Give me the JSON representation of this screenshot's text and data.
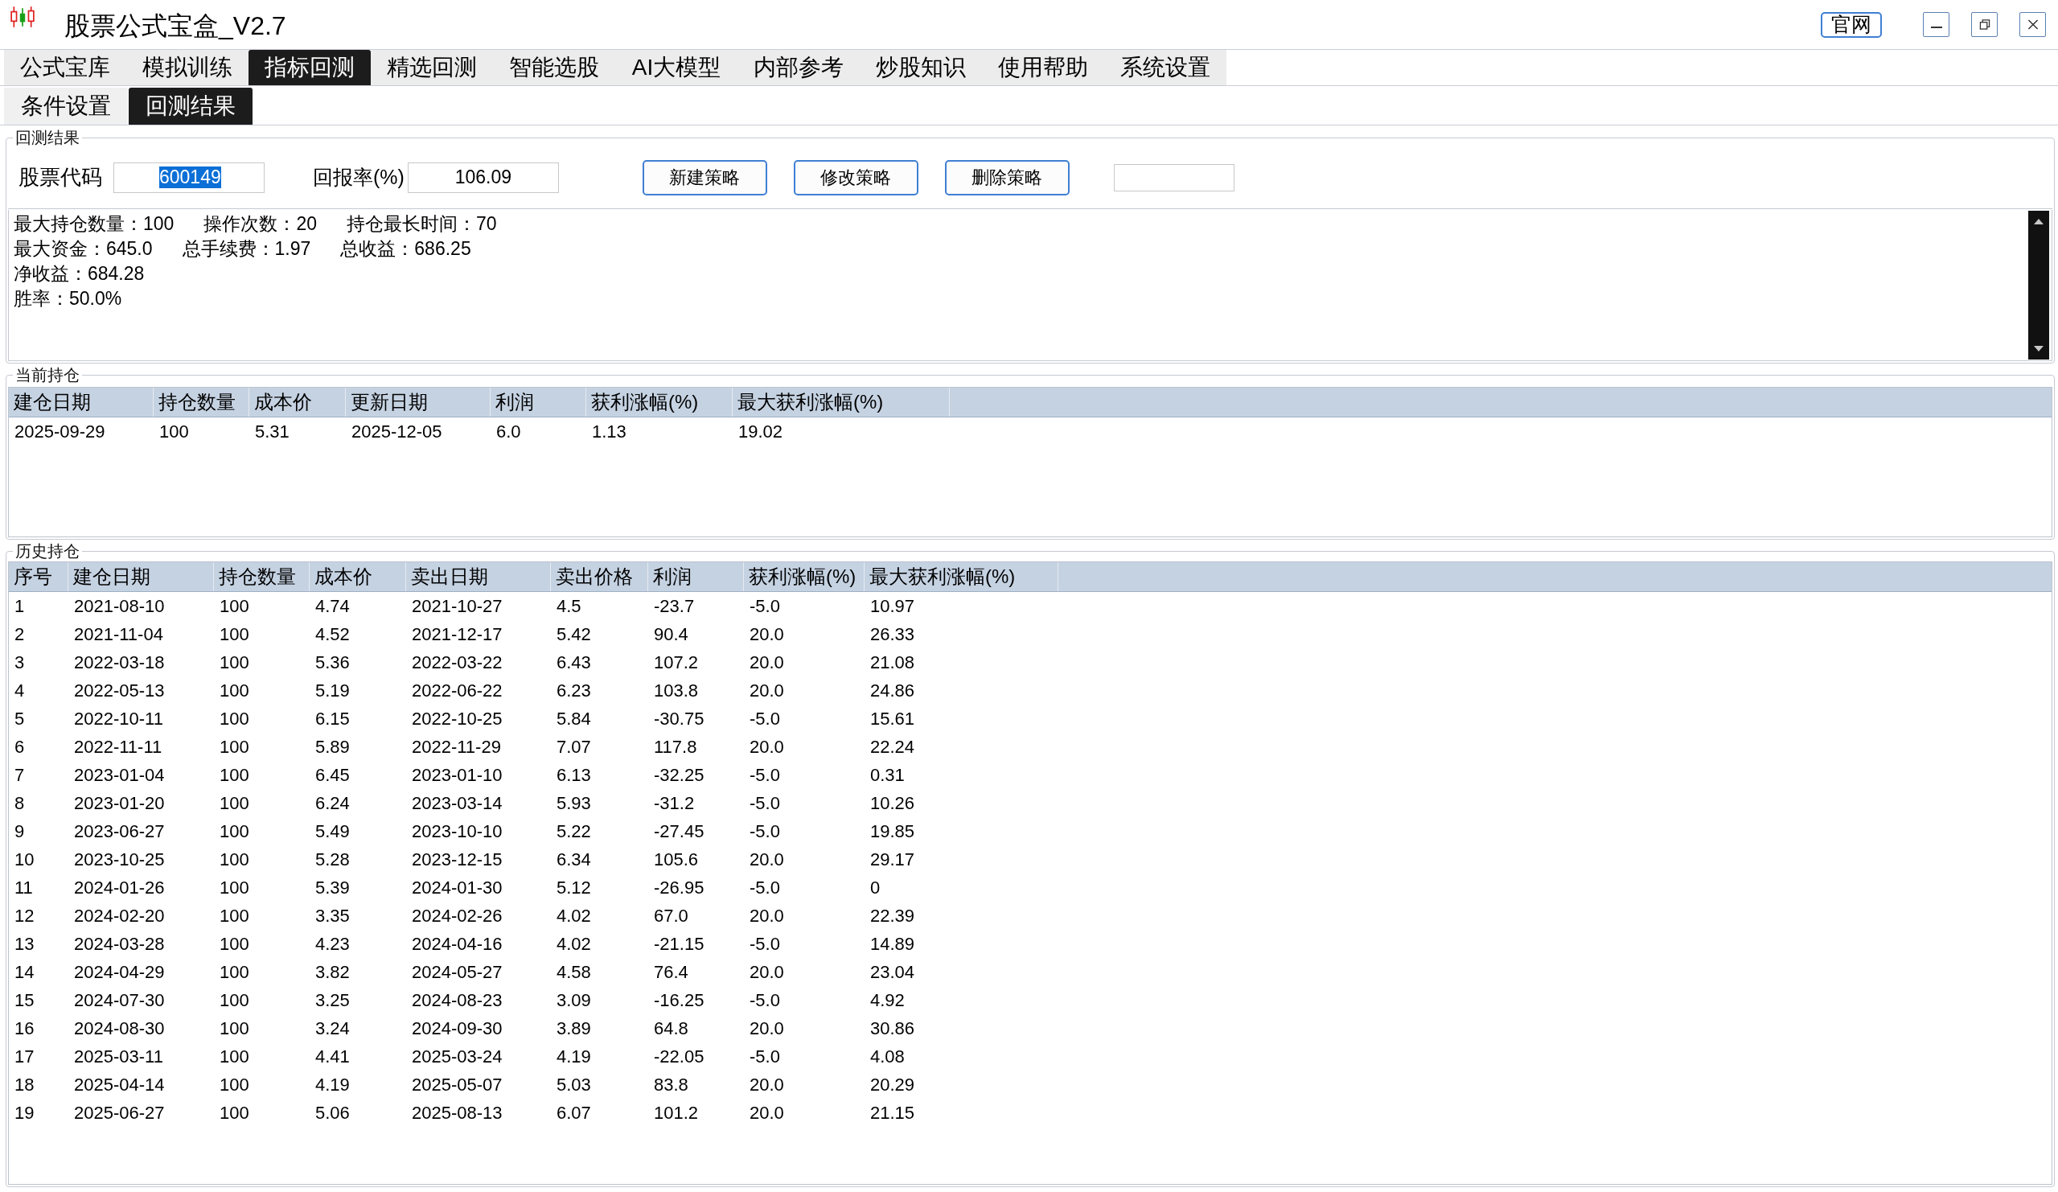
{
  "window": {
    "title": "股票公式宝盒_V2.7",
    "website_button": "官网"
  },
  "tabs": [
    {
      "label": "公式宝库",
      "selected": false
    },
    {
      "label": "模拟训练",
      "selected": false
    },
    {
      "label": "指标回测",
      "selected": true
    },
    {
      "label": "精选回测",
      "selected": false
    },
    {
      "label": "智能选股",
      "selected": false
    },
    {
      "label": "AI大模型",
      "selected": false
    },
    {
      "label": "内部参考",
      "selected": false
    },
    {
      "label": "炒股知识",
      "selected": false
    },
    {
      "label": "使用帮助",
      "selected": false
    },
    {
      "label": "系统设置",
      "selected": false
    }
  ],
  "sub_tabs": [
    {
      "label": "条件设置",
      "selected": false
    },
    {
      "label": "回测结果",
      "selected": true
    }
  ],
  "backtest_result": {
    "title": "回测结果",
    "stock_code": {
      "label": "股票代码",
      "value": "600149",
      "highlighted": true
    },
    "return_rate": {
      "label": "回报率(%)",
      "value": "106.09"
    },
    "buttons": [
      "新建策略",
      "修改策略",
      "删除策略"
    ],
    "stats": [
      [
        "最大持仓数量：100",
        "操作次数：20",
        "持仓最长时间：70"
      ],
      [
        "最大资金：645.0",
        "总手续费：1.97",
        "总收益：686.25"
      ],
      [
        "净收益：684.28"
      ],
      [
        "胜率：50.0%"
      ]
    ]
  },
  "current_holdings": {
    "title": "当前持仓",
    "columns": [
      "建仓日期",
      "持仓数量",
      "成本价",
      "更新日期",
      "利润",
      "获利涨幅(%)",
      "最大获利涨幅(%)"
    ],
    "rows": [
      [
        "2025-09-29",
        "100",
        "5.31",
        "2025-12-05",
        "6.0",
        "1.13",
        "19.02"
      ]
    ]
  },
  "history_holdings": {
    "title": "历史持仓",
    "columns": [
      "序号",
      "建仓日期",
      "持仓数量",
      "成本价",
      "卖出日期",
      "卖出价格",
      "利润",
      "获利涨幅(%)",
      "最大获利涨幅(%)"
    ],
    "rows": [
      [
        "1",
        "2021-08-10",
        "100",
        "4.74",
        "2021-10-27",
        "4.5",
        "-23.7",
        "-5.0",
        "10.97"
      ],
      [
        "2",
        "2021-11-04",
        "100",
        "4.52",
        "2021-12-17",
        "5.42",
        "90.4",
        "20.0",
        "26.33"
      ],
      [
        "3",
        "2022-03-18",
        "100",
        "5.36",
        "2022-03-22",
        "6.43",
        "107.2",
        "20.0",
        "21.08"
      ],
      [
        "4",
        "2022-05-13",
        "100",
        "5.19",
        "2022-06-22",
        "6.23",
        "103.8",
        "20.0",
        "24.86"
      ],
      [
        "5",
        "2022-10-11",
        "100",
        "6.15",
        "2022-10-25",
        "5.84",
        "-30.75",
        "-5.0",
        "15.61"
      ],
      [
        "6",
        "2022-11-11",
        "100",
        "5.89",
        "2022-11-29",
        "7.07",
        "117.8",
        "20.0",
        "22.24"
      ],
      [
        "7",
        "2023-01-04",
        "100",
        "6.45",
        "2023-01-10",
        "6.13",
        "-32.25",
        "-5.0",
        "0.31"
      ],
      [
        "8",
        "2023-01-20",
        "100",
        "6.24",
        "2023-03-14",
        "5.93",
        "-31.2",
        "-5.0",
        "10.26"
      ],
      [
        "9",
        "2023-06-27",
        "100",
        "5.49",
        "2023-10-10",
        "5.22",
        "-27.45",
        "-5.0",
        "19.85"
      ],
      [
        "10",
        "2023-10-25",
        "100",
        "5.28",
        "2023-12-15",
        "6.34",
        "105.6",
        "20.0",
        "29.17"
      ],
      [
        "11",
        "2024-01-26",
        "100",
        "5.39",
        "2024-01-30",
        "5.12",
        "-26.95",
        "-5.0",
        "0"
      ],
      [
        "12",
        "2024-02-20",
        "100",
        "3.35",
        "2024-02-26",
        "4.02",
        "67.0",
        "20.0",
        "22.39"
      ],
      [
        "13",
        "2024-03-28",
        "100",
        "4.23",
        "2024-04-16",
        "4.02",
        "-21.15",
        "-5.0",
        "14.89"
      ],
      [
        "14",
        "2024-04-29",
        "100",
        "3.82",
        "2024-05-27",
        "4.58",
        "76.4",
        "20.0",
        "23.04"
      ],
      [
        "15",
        "2024-07-30",
        "100",
        "3.25",
        "2024-08-23",
        "3.09",
        "-16.25",
        "-5.0",
        "4.92"
      ],
      [
        "16",
        "2024-08-30",
        "100",
        "3.24",
        "2024-09-30",
        "3.89",
        "64.8",
        "20.0",
        "30.86"
      ],
      [
        "17",
        "2025-03-11",
        "100",
        "4.41",
        "2025-03-24",
        "4.19",
        "-22.05",
        "-5.0",
        "4.08"
      ],
      [
        "18",
        "2025-04-14",
        "100",
        "4.19",
        "2025-05-07",
        "5.03",
        "83.8",
        "20.0",
        "20.29"
      ],
      [
        "19",
        "2025-06-27",
        "100",
        "5.06",
        "2025-08-13",
        "6.07",
        "101.2",
        "20.0",
        "21.15"
      ]
    ]
  }
}
